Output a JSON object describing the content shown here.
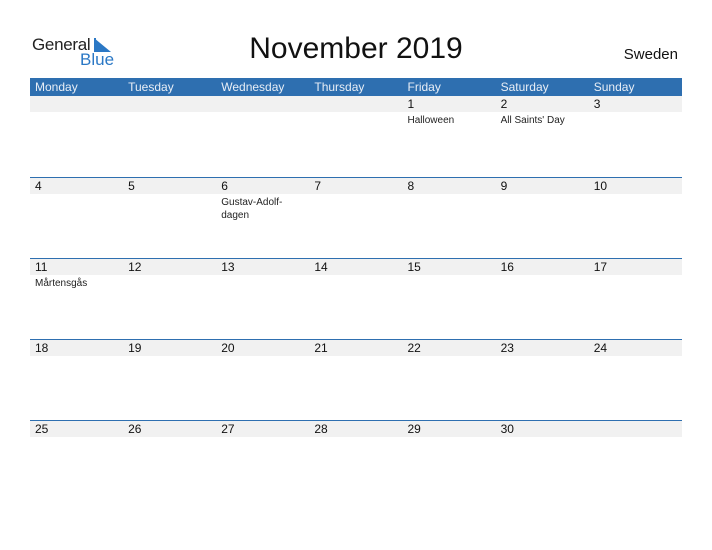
{
  "logo": {
    "line1": "General",
    "line2": "Blue"
  },
  "title": "November 2019",
  "country": "Sweden",
  "colors": {
    "header_bg": "#2e6fb0",
    "accent": "#2b78c5",
    "day_strip": "#f1f1f1"
  },
  "weekdays": [
    "Monday",
    "Tuesday",
    "Wednesday",
    "Thursday",
    "Friday",
    "Saturday",
    "Sunday"
  ],
  "weeks": [
    [
      {
        "day": "",
        "event": ""
      },
      {
        "day": "",
        "event": ""
      },
      {
        "day": "",
        "event": ""
      },
      {
        "day": "",
        "event": ""
      },
      {
        "day": "1",
        "event": "Halloween"
      },
      {
        "day": "2",
        "event": "All Saints' Day"
      },
      {
        "day": "3",
        "event": ""
      }
    ],
    [
      {
        "day": "4",
        "event": ""
      },
      {
        "day": "5",
        "event": ""
      },
      {
        "day": "6",
        "event": "Gustav-Adolf-dagen"
      },
      {
        "day": "7",
        "event": ""
      },
      {
        "day": "8",
        "event": ""
      },
      {
        "day": "9",
        "event": ""
      },
      {
        "day": "10",
        "event": ""
      }
    ],
    [
      {
        "day": "11",
        "event": "Mårtensgås"
      },
      {
        "day": "12",
        "event": ""
      },
      {
        "day": "13",
        "event": ""
      },
      {
        "day": "14",
        "event": ""
      },
      {
        "day": "15",
        "event": ""
      },
      {
        "day": "16",
        "event": ""
      },
      {
        "day": "17",
        "event": ""
      }
    ],
    [
      {
        "day": "18",
        "event": ""
      },
      {
        "day": "19",
        "event": ""
      },
      {
        "day": "20",
        "event": ""
      },
      {
        "day": "21",
        "event": ""
      },
      {
        "day": "22",
        "event": ""
      },
      {
        "day": "23",
        "event": ""
      },
      {
        "day": "24",
        "event": ""
      }
    ],
    [
      {
        "day": "25",
        "event": ""
      },
      {
        "day": "26",
        "event": ""
      },
      {
        "day": "27",
        "event": ""
      },
      {
        "day": "28",
        "event": ""
      },
      {
        "day": "29",
        "event": ""
      },
      {
        "day": "30",
        "event": ""
      },
      {
        "day": "",
        "event": ""
      }
    ]
  ]
}
